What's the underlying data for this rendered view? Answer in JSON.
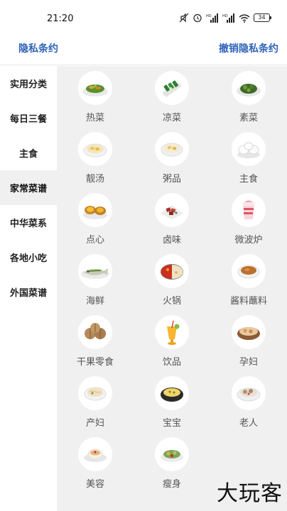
{
  "status_bar": {
    "time": "21:20",
    "battery": "34"
  },
  "header": {
    "left_link": "隐私条约",
    "right_link": "撤销隐私条约"
  },
  "sidebar": {
    "items": [
      {
        "label": "实用分类",
        "active": false
      },
      {
        "label": "每日三餐",
        "active": false
      },
      {
        "label": "主食",
        "active": false
      },
      {
        "label": "家常菜谱",
        "active": true
      },
      {
        "label": "中华菜系",
        "active": false
      },
      {
        "label": "各地小吃",
        "active": false
      },
      {
        "label": "外国菜谱",
        "active": false
      }
    ]
  },
  "grid": {
    "items": [
      {
        "label": "热菜",
        "icon": "stir-fry-dish-icon"
      },
      {
        "label": "凉菜",
        "icon": "cucumber-salad-icon"
      },
      {
        "label": "素菜",
        "icon": "greens-dish-icon"
      },
      {
        "label": "靓汤",
        "icon": "soup-bowl-icon"
      },
      {
        "label": "粥品",
        "icon": "porridge-bowl-icon"
      },
      {
        "label": "主食",
        "icon": "buns-icon"
      },
      {
        "label": "点心",
        "icon": "egg-tart-icon"
      },
      {
        "label": "卤味",
        "icon": "braised-meat-icon"
      },
      {
        "label": "微波炉",
        "icon": "microwave-cup-icon"
      },
      {
        "label": "海鲜",
        "icon": "fish-platter-icon"
      },
      {
        "label": "火锅",
        "icon": "hotpot-icon"
      },
      {
        "label": "酱料蘸料",
        "icon": "sauce-bowl-icon"
      },
      {
        "label": "干果零食",
        "icon": "walnuts-icon"
      },
      {
        "label": "饮品",
        "icon": "juice-glass-icon"
      },
      {
        "label": "孕妇",
        "icon": "stew-bowl-icon"
      },
      {
        "label": "产妇",
        "icon": "noodle-soup-icon"
      },
      {
        "label": "宝宝",
        "icon": "egg-custard-icon"
      },
      {
        "label": "老人",
        "icon": "meatball-soup-icon"
      },
      {
        "label": "美容",
        "icon": "dessert-cup-icon"
      },
      {
        "label": "瘦身",
        "icon": "salad-icon"
      }
    ]
  },
  "watermark": "大玩客",
  "colors": {
    "accent": "#2f63b9",
    "content_bg": "#f0f0f0",
    "sidebar_bg": "#ffffff"
  }
}
